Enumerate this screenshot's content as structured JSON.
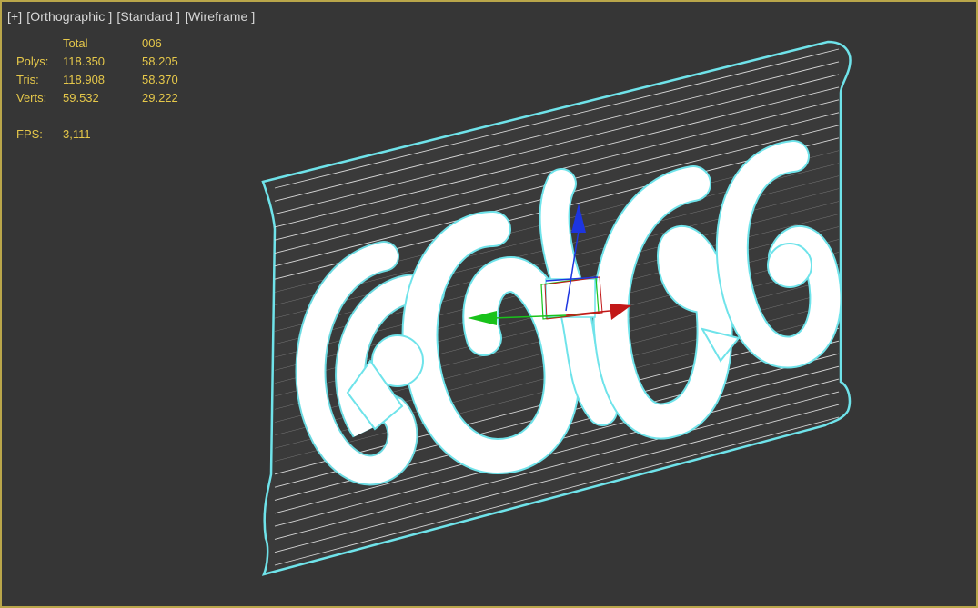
{
  "viewport": {
    "labels": [
      "[+]",
      "[Orthographic ]",
      "[Standard ]",
      "[Wireframe ]"
    ]
  },
  "stats": {
    "header_total": "Total",
    "header_object": "006",
    "rows": [
      {
        "label": "Polys:",
        "total": "118.350",
        "object": "58.205"
      },
      {
        "label": "Tris:",
        "total": "118.908",
        "object": "58.370"
      },
      {
        "label": "Verts:",
        "total": "59.532",
        "object": "29.222"
      }
    ],
    "fps_label": "FPS:",
    "fps_value": "3,111"
  },
  "colors": {
    "background": "#363636",
    "border": "#b9a64a",
    "stats_text": "#e6c84a",
    "label_text": "#d8d8d8",
    "wire": "#ffffff",
    "selection_outline": "#6fe3ea",
    "gizmo_x": "#c21818",
    "gizmo_y": "#19c21b",
    "gizmo_z": "#1d35e0"
  }
}
